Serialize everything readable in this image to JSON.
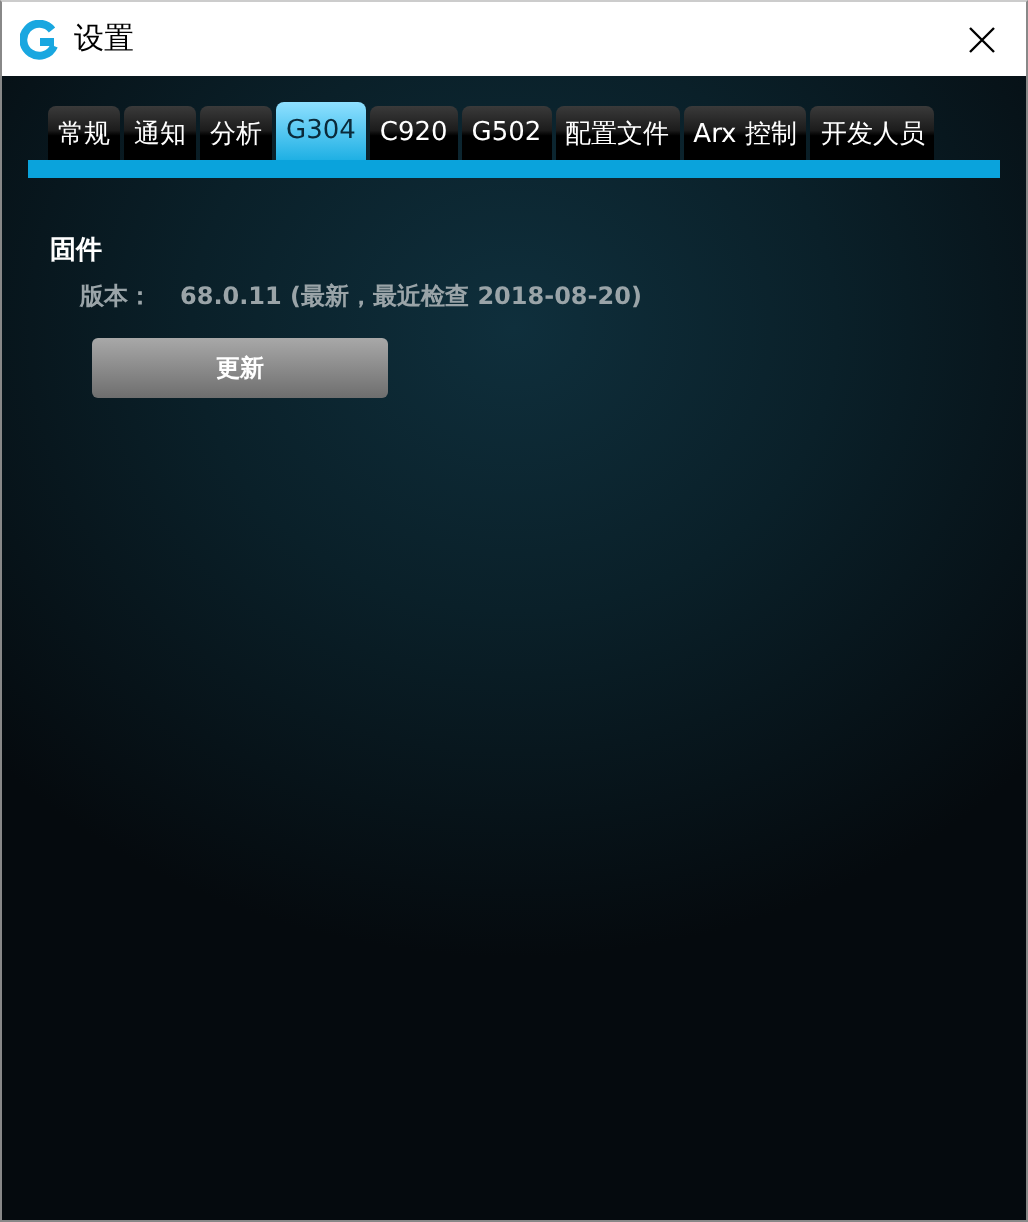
{
  "window": {
    "title": "设置"
  },
  "tabs": [
    {
      "label": "常规",
      "selected": false
    },
    {
      "label": "通知",
      "selected": false
    },
    {
      "label": "分析",
      "selected": false
    },
    {
      "label": "G304",
      "selected": true
    },
    {
      "label": "C920",
      "selected": false
    },
    {
      "label": "G502",
      "selected": false
    },
    {
      "label": "配置文件",
      "selected": false
    },
    {
      "label": "Arx 控制",
      "selected": false
    },
    {
      "label": "开发人员",
      "selected": false
    }
  ],
  "firmware": {
    "heading": "固件",
    "version_label": "版本：",
    "version_value": "68.0.11 (最新，最近检查 2018-08-20)",
    "button": "更新"
  }
}
